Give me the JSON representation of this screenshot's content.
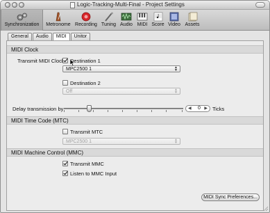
{
  "window": {
    "title": "Logic-Tracking-Multi-Final - Project Settings"
  },
  "toolbar": {
    "items": [
      {
        "label": "Synchronization",
        "icon": "synchronization-icon"
      },
      {
        "label": "Metronome",
        "icon": "metronome-icon"
      },
      {
        "label": "Recording",
        "icon": "recording-icon"
      },
      {
        "label": "Tuning",
        "icon": "tuning-icon"
      },
      {
        "label": "Audio",
        "icon": "audio-icon"
      },
      {
        "label": "MIDI",
        "icon": "midi-icon"
      },
      {
        "label": "Score",
        "icon": "score-icon"
      },
      {
        "label": "Video",
        "icon": "video-icon"
      },
      {
        "label": "Assets",
        "icon": "assets-icon"
      }
    ],
    "selected": "Synchronization"
  },
  "tabs": {
    "items": [
      "General",
      "Audio",
      "MIDI",
      "Unitor"
    ],
    "active": "MIDI"
  },
  "midi_clock": {
    "header": "MIDI Clock",
    "transmit_label": "Transmit MIDI Clock:",
    "destination1": {
      "label": "Destination 1",
      "checked": true,
      "value": "MPC2500 1"
    },
    "destination2": {
      "label": "Destination 2",
      "checked": false,
      "value": "Off"
    },
    "delay_label": "Delay transmission by:",
    "delay_value": "0",
    "delay_unit": "Ticks"
  },
  "mtc": {
    "header": "MIDI Time Code (MTC)",
    "transmit_label": "Transmit MTC",
    "checked": false,
    "value": "MPC2500 1"
  },
  "mmc": {
    "header": "MIDI Machine Control (MMC)",
    "transmit_label": "Transmit MMC",
    "transmit_checked": true,
    "listen_label": "Listen to MMC Input",
    "listen_checked": true
  },
  "footer": {
    "sync_prefs_label": "MIDI Sync Preferences..."
  },
  "colors": {
    "recording_red": "#d8262b",
    "selected_toolbar": "#aeaeae"
  }
}
